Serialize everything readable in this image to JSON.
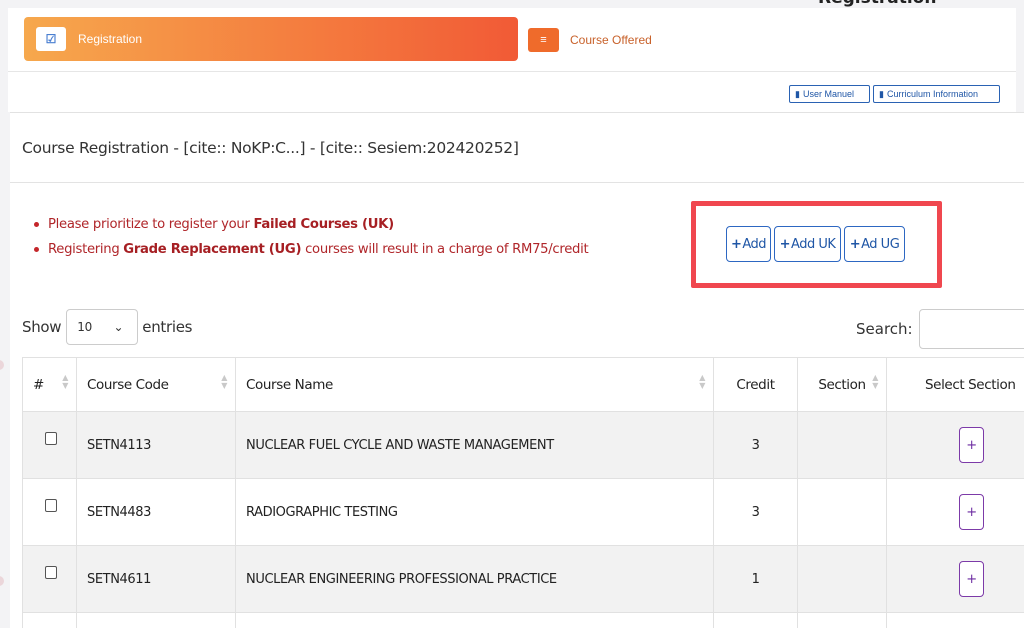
{
  "top_clipped_text": "Registration",
  "wizard": {
    "step1_label": "Registration",
    "step2_label": "Course Offered"
  },
  "links": {
    "user_manual": "User Manuel",
    "curriculum": "Curriculum Information"
  },
  "card": {
    "title": "Course Registration - [cite:: NoKP:C...] - [cite:: Sesiem:202420252]"
  },
  "notes": [
    {
      "pre": "Please prioritize to register your ",
      "bold": "Failed Courses (UK)",
      "post": ""
    },
    {
      "pre": "Registering ",
      "bold": "Grade Replacement (UG)",
      "post": " courses will result in a charge of RM75/credit"
    }
  ],
  "actions": {
    "add": "Add",
    "add_uk": "Add UK",
    "add_ug": "Ad UG"
  },
  "table_controls": {
    "show_label": "Show",
    "entries_value": "10",
    "entries_label": "entries",
    "search_label": "Search:"
  },
  "table": {
    "headers": [
      "#",
      "Course Code",
      "Course Name",
      "Credit",
      "Section",
      "Select Section"
    ],
    "rows": [
      {
        "code": "SETN4113",
        "name": "NUCLEAR FUEL CYCLE AND WASTE MANAGEMENT",
        "credit": "3",
        "section": ""
      },
      {
        "code": "SETN4483",
        "name": "RADIOGRAPHIC TESTING",
        "credit": "3",
        "section": ""
      },
      {
        "code": "SETN4611",
        "name": "NUCLEAR ENGINEERING PROFESSIONAL PRACTICE",
        "credit": "1",
        "section": ""
      }
    ]
  },
  "icons": {
    "step1": "check-square-icon",
    "step2": "list-icon",
    "doc": "file-icon",
    "plus": "plus-icon"
  },
  "colors": {
    "accent_orange": "#f47a3e",
    "link_blue": "#1f56a6",
    "warning_red": "#b0262a",
    "highlight_red": "#f0474f",
    "purple": "#7c3aa8"
  }
}
